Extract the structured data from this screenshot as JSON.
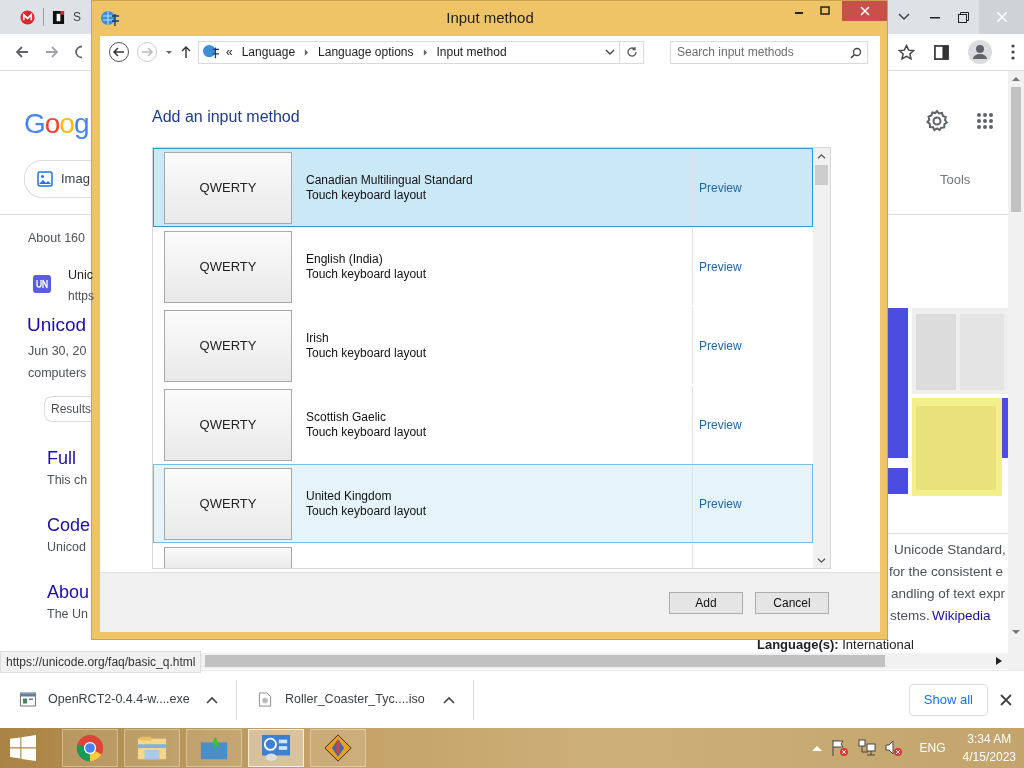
{
  "browser": {
    "tab_partial": "S",
    "google": {
      "logo": "Goog",
      "chip": "Imag",
      "result_count": "About 160",
      "site_name": "Unic",
      "site_url": "https",
      "result_title": "Unicod",
      "snippet_lines": [
        "Jun 30, 20",
        "computers"
      ],
      "results_chip": "Results",
      "sublinks": [
        {
          "title": "Full",
          "text": "This ch"
        },
        {
          "title": "Code",
          "text": "Unicod"
        },
        {
          "title": "Abou",
          "text": "The Un"
        }
      ],
      "tools": "Tools",
      "panel_lines": [
        "Unicode Standard,",
        "for the consistent e",
        "andling of text expr"
      ],
      "panel_last": "stems.",
      "panel_link": "Wikipedia",
      "language": "**Language(s):** International"
    },
    "status_url": "https://unicode.org/faq/basic_q.html"
  },
  "dialog": {
    "title": "Input method",
    "overflow_mark": "«",
    "breadcrumb": [
      "Language",
      "Language options",
      "Input method"
    ],
    "search": {
      "placeholder": "Search input methods"
    },
    "heading": "Add an input method",
    "methods": [
      {
        "key_label": "QWERTY",
        "name": "Canadian Multilingual Standard",
        "layout": "Touch keyboard layout",
        "preview": "Preview",
        "selected": true,
        "hovered": false
      },
      {
        "key_label": "QWERTY",
        "name": "English (India)",
        "layout": "Touch keyboard layout",
        "preview": "Preview",
        "selected": false,
        "hovered": false
      },
      {
        "key_label": "QWERTY",
        "name": "Irish",
        "layout": "Touch keyboard layout",
        "preview": "Preview",
        "selected": false,
        "hovered": false
      },
      {
        "key_label": "QWERTY",
        "name": "Scottish Gaelic",
        "layout": "Touch keyboard layout",
        "preview": "Preview",
        "selected": false,
        "hovered": false
      },
      {
        "key_label": "QWERTY",
        "name": "United Kingdom",
        "layout": "Touch keyboard layout",
        "preview": "Preview",
        "selected": false,
        "hovered": true
      }
    ],
    "more_below": true,
    "buttons": [
      "Add",
      "Cancel"
    ]
  },
  "downloads": {
    "items": [
      {
        "name": "OpenRCT2-0.4.4-w....exe",
        "kind": "exe"
      },
      {
        "name": "Roller_Coaster_Tyc....iso",
        "kind": "iso"
      }
    ],
    "show_all": "Show all"
  },
  "taskbar": {
    "apps": [
      {
        "kind": "chrome",
        "selected": false
      },
      {
        "kind": "explorer",
        "selected": false
      },
      {
        "kind": "installer",
        "selected": false
      },
      {
        "kind": "control",
        "selected": true
      },
      {
        "kind": "game",
        "selected": false
      }
    ],
    "language": "ENG",
    "time": "3:34 AM",
    "date": "4/15/2023"
  }
}
